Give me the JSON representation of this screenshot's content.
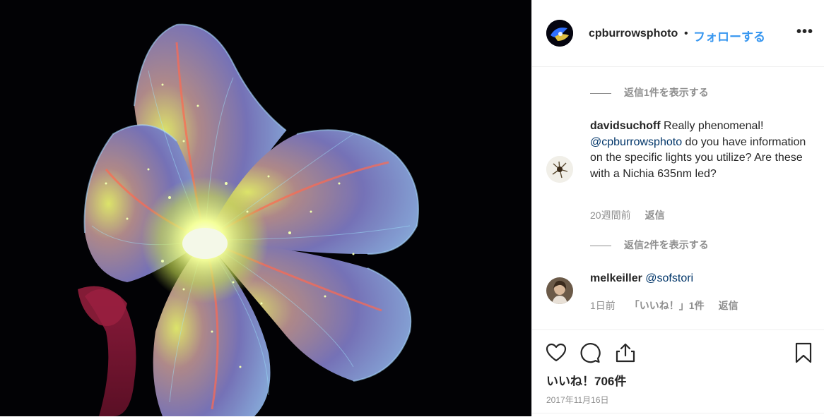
{
  "post": {
    "author": "cpburrowsphoto",
    "separator": "•",
    "follow_label": "フォローする",
    "more_label": "•••"
  },
  "comments": {
    "view_replies_1": "返信1件を表示する",
    "comment1": {
      "user": "davidsuchoff",
      "text_before": " Really phenomenal! ",
      "mention": "@cpburrowsphoto",
      "text_after": " do you have information on the specific lights you utilize? Are these with a Nichia 635nm led?",
      "time": "20週間前",
      "reply_label": "返信"
    },
    "view_replies_2": "返信2件を表示する",
    "comment2": {
      "user": "melkeiller",
      "mention": "@sofstori",
      "time": "1日前",
      "likes": "「いいね！」1件",
      "reply_label": "返信"
    }
  },
  "actions": {
    "like_icon": "heart-icon",
    "comment_icon": "comment-icon",
    "share_icon": "share-icon",
    "save_icon": "bookmark-icon",
    "likes_text": "いいね！706件",
    "date": "2017年11月16日"
  }
}
